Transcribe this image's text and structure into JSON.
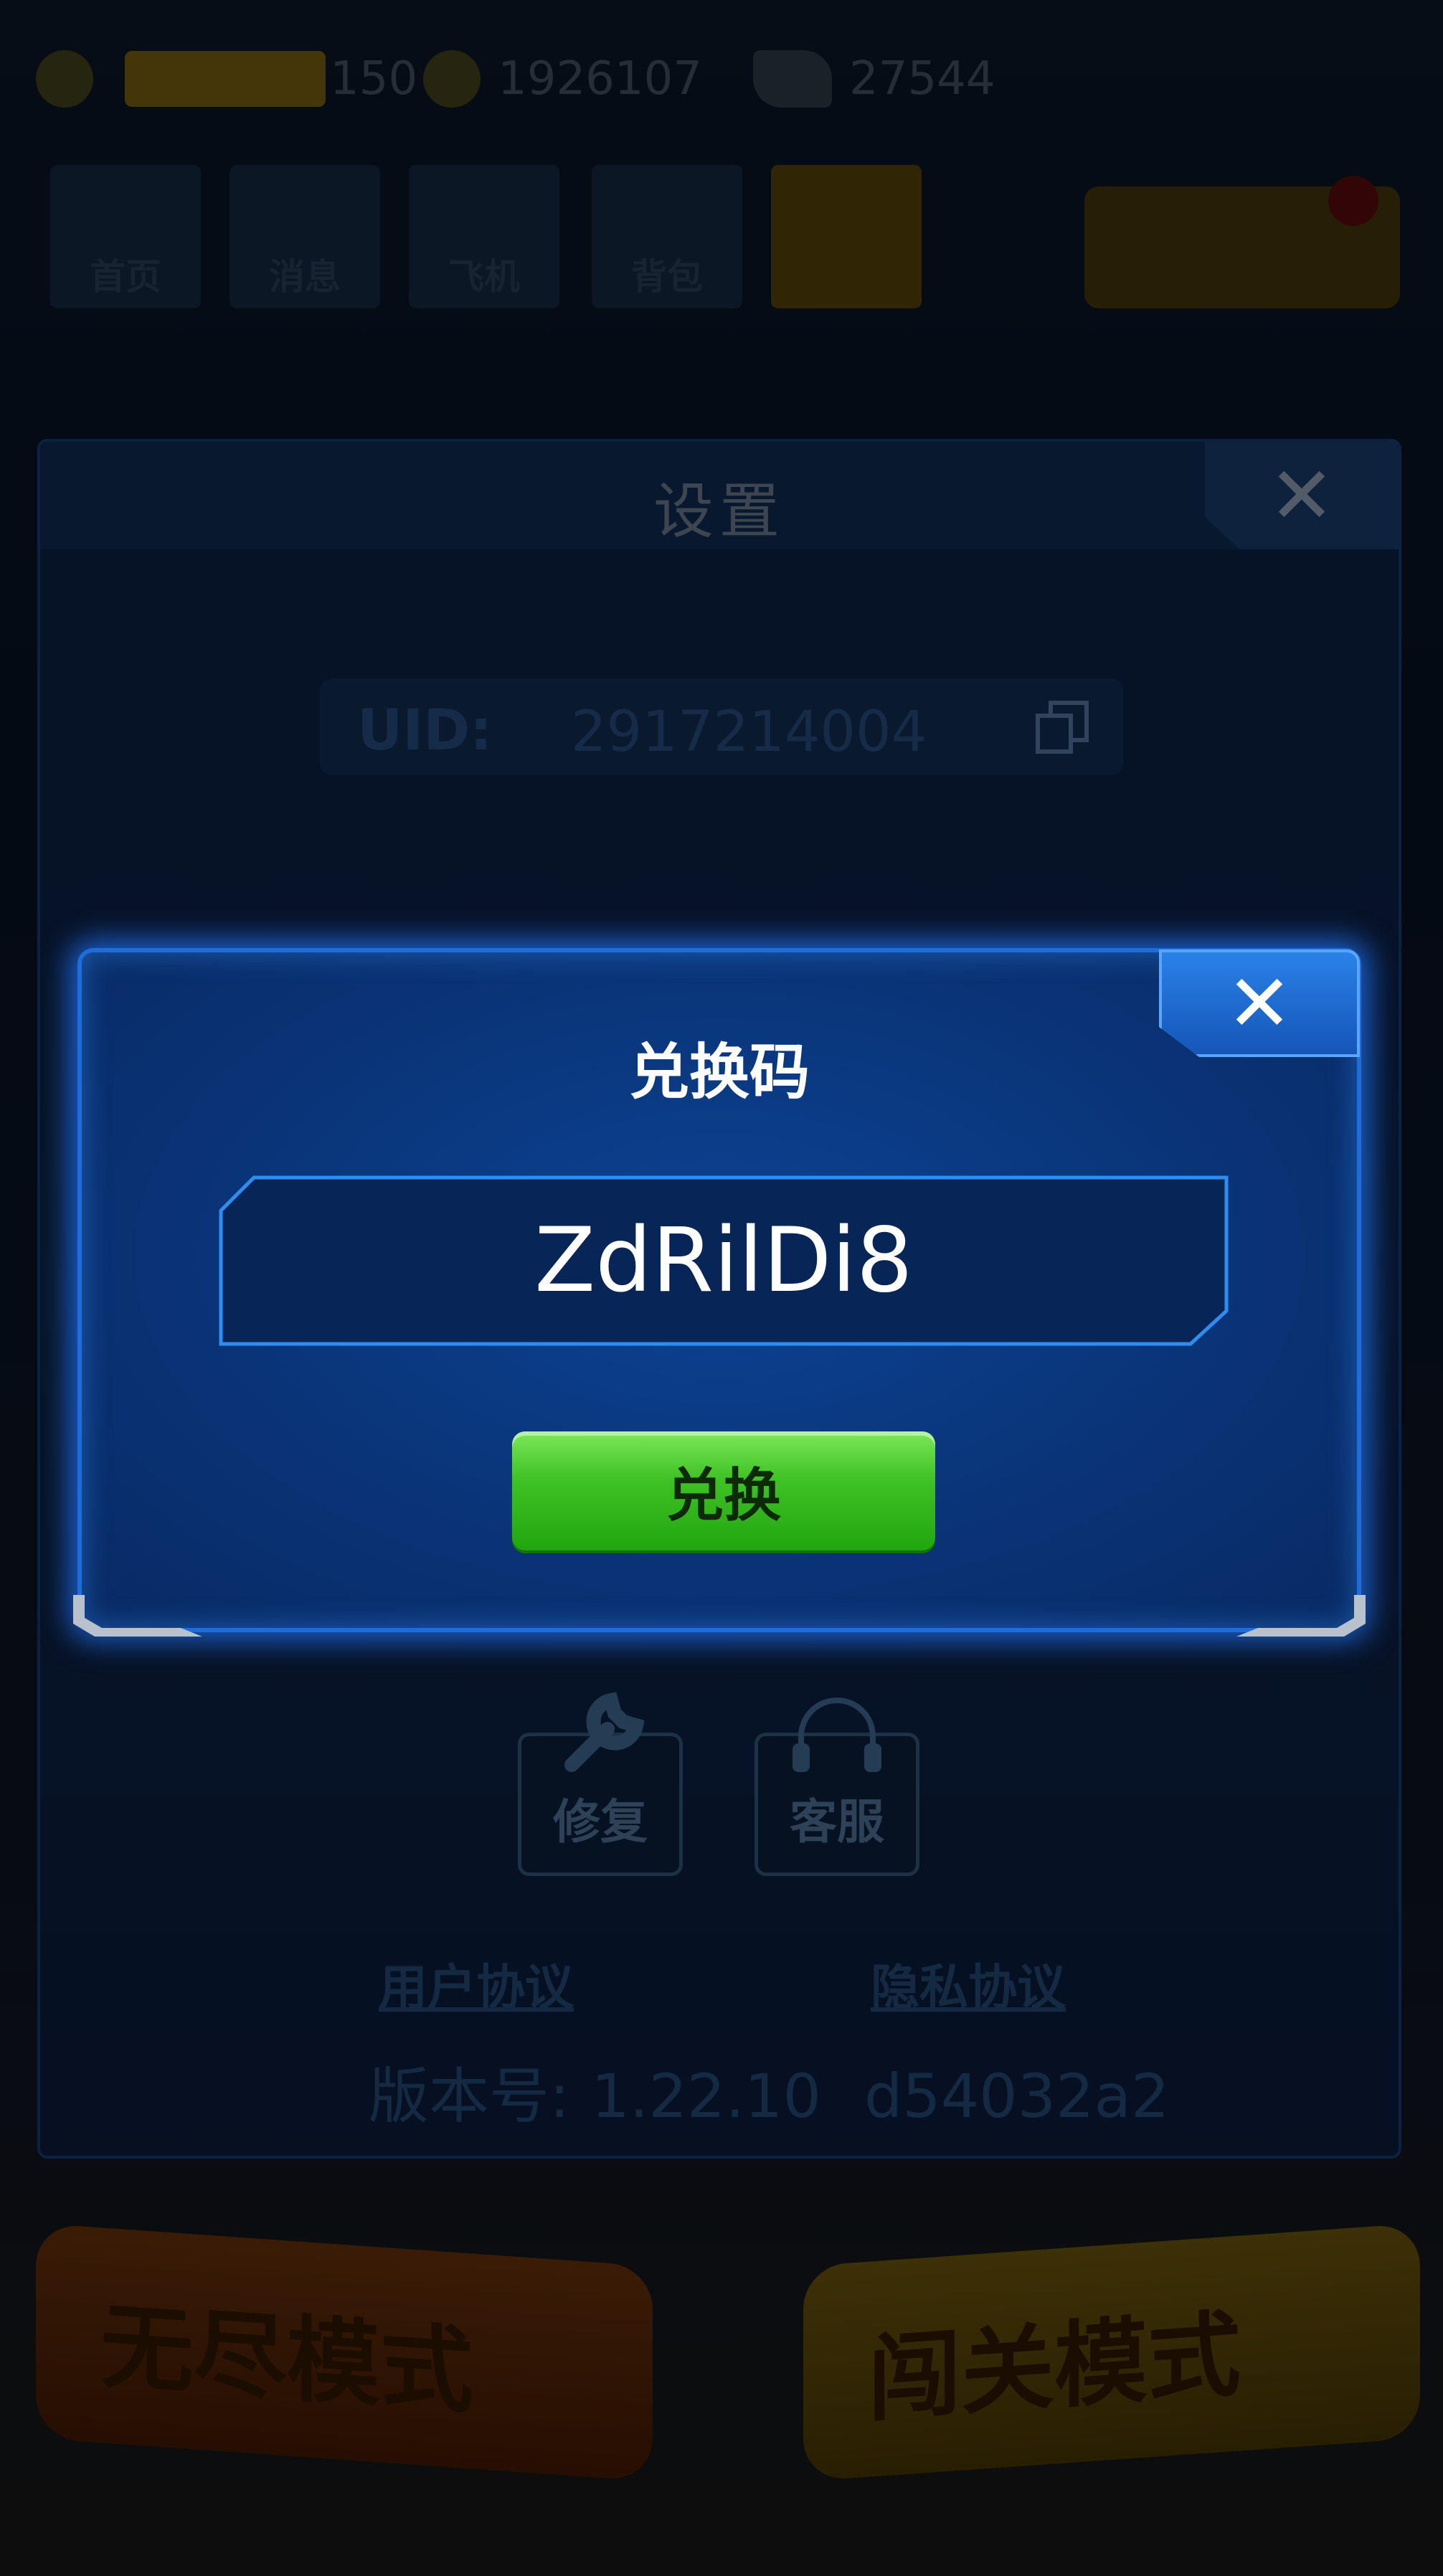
{
  "status_bar": {
    "energy_value": "150",
    "coins": "1926107",
    "gems": "27544"
  },
  "nav": {
    "items": [
      {
        "label": "首页",
        "icon": "home-icon"
      },
      {
        "label": "消息",
        "icon": "message-icon"
      },
      {
        "label": "飞机",
        "icon": "plane-icon"
      },
      {
        "label": "背包",
        "icon": "bag-icon"
      },
      {
        "label": "",
        "icon": "gold-icon"
      }
    ],
    "notification_count": "1"
  },
  "settings": {
    "title": "设置",
    "uid_label": "UID:",
    "uid_value": "2917214004",
    "repair_label": "修复",
    "service_label": "客服",
    "user_agreement": "用户协议",
    "privacy_policy": "隐私协议",
    "version_label": "版本号:",
    "version_number": "1.22.10",
    "version_hash": "d54032a2"
  },
  "redeem": {
    "title": "兑换码",
    "code_value": "ZdRilDi8",
    "button_label": "兑换"
  },
  "modes": {
    "endless": "无尽模式",
    "stage": "闯关模式"
  },
  "colors": {
    "dialog_border": "#1f6ddb",
    "redeem_button": "#3fc225"
  }
}
